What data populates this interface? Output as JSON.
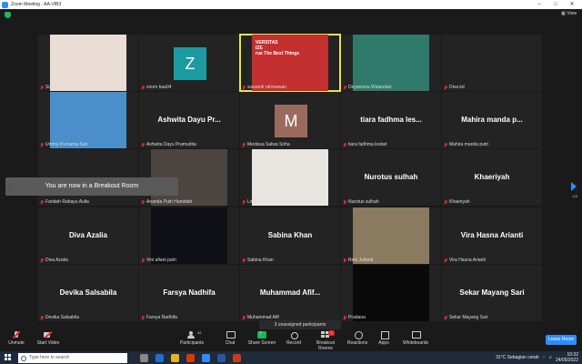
{
  "window": {
    "title": "Zoom Meeting - AA-VIB3"
  },
  "view_label": "▦ View",
  "tiles": [
    {
      "name": "Siska Ara Ara",
      "initial": "",
      "tile_type": "photo",
      "color": "#e9ddd5"
    },
    {
      "name": "zoom baa04",
      "initial": "Z",
      "tile_type": "avatar",
      "color": "#1c9aa1"
    },
    {
      "name": "suwandi rahmawan",
      "initial": "",
      "tile_type": "photo",
      "color": "#c43030",
      "speaking": true,
      "overlay": "VERSITAS\nIZE\nrue The Best Things"
    },
    {
      "name": "Deyannisa Wulandari",
      "initial": "",
      "tile_type": "photo",
      "color": "#2f7a6a"
    },
    {
      "name": "Diva kd",
      "initial": "",
      "tile_type": "blank",
      "color": "#232323"
    },
    {
      "name": "Ummy Purnama Sari",
      "initial": "",
      "tile_type": "photo",
      "color": "#4a8fc9"
    },
    {
      "name": "Ashwita Dayu Pramudita",
      "display": "Ashwita Dayu Pr...",
      "initial": "",
      "tile_type": "name"
    },
    {
      "name": "Medissa Salwa Soha",
      "initial": "M",
      "tile_type": "avatar",
      "color": "#9a6b5c"
    },
    {
      "name": "tiara fadhma lestari",
      "display": "tiara fadhma les...",
      "initial": "",
      "tile_type": "name"
    },
    {
      "name": "Mahira manda putri",
      "display": "Mahira manda p...",
      "initial": "",
      "tile_type": "name"
    },
    {
      "name": "Faridah Rahayu Aulia",
      "initial": "",
      "tile_type": "blank"
    },
    {
      "name": "Ananda Putri Hamidah",
      "initial": "",
      "tile_type": "photo",
      "color": "#4d4540"
    },
    {
      "name": "Linda Nova",
      "initial": "",
      "tile_type": "photo",
      "color": "#e8e4e0"
    },
    {
      "name": "Nurotus sulhah",
      "display": "Nurotus sulhah",
      "initial": "",
      "tile_type": "name"
    },
    {
      "name": "Khaeriyah",
      "display": "Khaeriyah",
      "initial": "",
      "tile_type": "name"
    },
    {
      "name": "Diva Azalia",
      "display": "Diva Azalia",
      "initial": "",
      "tile_type": "name"
    },
    {
      "name": "Vini afiani putri",
      "initial": "",
      "tile_type": "photo",
      "color": "#101018"
    },
    {
      "name": "Sabina Khan",
      "display": "Sabina Khan",
      "initial": "",
      "tile_type": "name"
    },
    {
      "name": "Reni Julianti",
      "initial": "",
      "tile_type": "photo",
      "color": "#8a7a60"
    },
    {
      "name": "Vira Hasna Arianti",
      "display": "Vira Hasna Arianti",
      "initial": "",
      "tile_type": "name"
    },
    {
      "name": "Devika Salsabila",
      "display": "Devika Salsabila",
      "initial": "",
      "tile_type": "name"
    },
    {
      "name": "Farsya Nadhifa",
      "display": "Farsya Nadhifa",
      "initial": "",
      "tile_type": "name"
    },
    {
      "name": "Muhammad Afif",
      "display": "Muhammad  Afif...",
      "initial": "",
      "tile_type": "name"
    },
    {
      "name": "Pradana",
      "initial": "",
      "tile_type": "photo",
      "color": "#0a0a0a"
    },
    {
      "name": "Sekar Mayang Sari",
      "display": "Sekar Mayang Sari",
      "initial": "",
      "tile_type": "name"
    }
  ],
  "breakout_toast": "You are now in a Breakout Room",
  "page_indicator": "1/2",
  "unassigned_label": "3 unassigned participants",
  "toolbar": {
    "unmute": "Unmute",
    "start_video": "Start Video",
    "participants": "Participants",
    "participants_count": "42",
    "chat": "Chat",
    "share_screen": "Share Screen",
    "record": "Record",
    "breakout_rooms": "Breakout Rooms",
    "breakout_badge": "1",
    "reactions": "Reactions",
    "apps": "Apps",
    "whiteboards": "Whiteboards",
    "leave_room": "Leave Room"
  },
  "taskbar": {
    "search_placeholder": "Type here to search",
    "weather": "31°C  Sebagian cerah",
    "time": "10:32",
    "date": "24/05/2022"
  },
  "colors": {
    "accent": "#2d8cff",
    "speaking_border": "#e4e64b",
    "muted_red": "#e02828"
  }
}
